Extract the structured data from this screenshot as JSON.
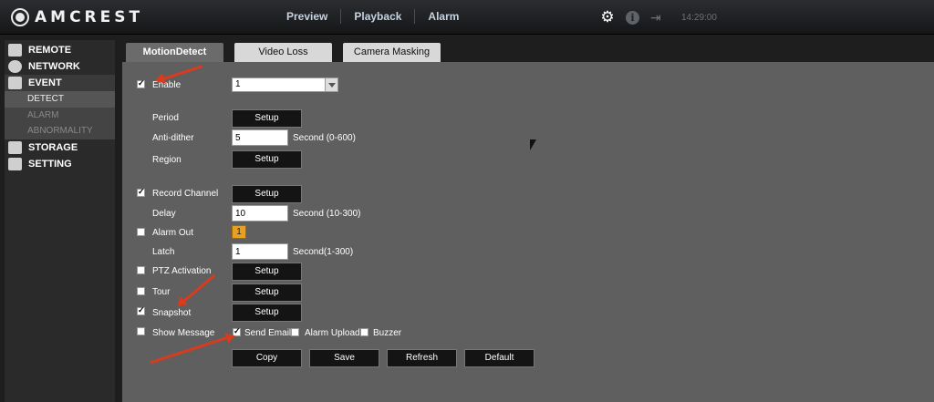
{
  "header": {
    "brand": "AMCREST",
    "nav": [
      "Preview",
      "Playback",
      "Alarm"
    ],
    "clock": "14:29:00",
    "icons": [
      "gear-icon",
      "info-icon",
      "logout-icon"
    ]
  },
  "sidebar": {
    "items": [
      {
        "label": "REMOTE",
        "icon": "camera-icon"
      },
      {
        "label": "NETWORK",
        "icon": "globe-icon"
      },
      {
        "label": "EVENT",
        "icon": "warning-icon"
      },
      {
        "label": "STORAGE",
        "icon": "storage-icon"
      },
      {
        "label": "SETTING",
        "icon": "monitor-icon"
      }
    ],
    "event_subs": [
      "DETECT",
      "ALARM",
      "ABNORMALITY"
    ]
  },
  "tabs": [
    "MotionDetect",
    "Video Loss",
    "Camera Masking"
  ],
  "form": {
    "enable": {
      "label": "Enable",
      "value": "1",
      "checked": true
    },
    "period": {
      "label": "Period",
      "button": "Setup"
    },
    "anti_dither": {
      "label": "Anti-dither",
      "value": "5",
      "unit": "Second (0-600)"
    },
    "region": {
      "label": "Region",
      "button": "Setup"
    },
    "record_channel": {
      "label": "Record Channel",
      "button": "Setup",
      "checked": true
    },
    "delay": {
      "label": "Delay",
      "value": "10",
      "unit": "Second (10-300)"
    },
    "alarm_out": {
      "label": "Alarm Out",
      "button": "1",
      "checked": false
    },
    "latch": {
      "label": "Latch",
      "value": "1",
      "unit": "Second(1-300)"
    },
    "ptz": {
      "label": "PTZ Activation",
      "button": "Setup",
      "checked": false
    },
    "tour": {
      "label": "Tour",
      "button": "Setup",
      "checked": false
    },
    "snapshot": {
      "label": "Snapshot",
      "button": "Setup",
      "checked": true
    },
    "show_message": {
      "label": "Show Message",
      "checked": false
    },
    "send_email": {
      "label": "Send Email",
      "checked": true
    },
    "alarm_upload": {
      "label": "Alarm Upload",
      "checked": false
    },
    "buzzer": {
      "label": "Buzzer",
      "checked": false
    }
  },
  "actions": {
    "copy": "Copy",
    "save": "Save",
    "refresh": "Refresh",
    "default": "Default"
  },
  "colors": {
    "annotation_arrow": "#d93b1e",
    "alarm_button": "#e8a020"
  }
}
